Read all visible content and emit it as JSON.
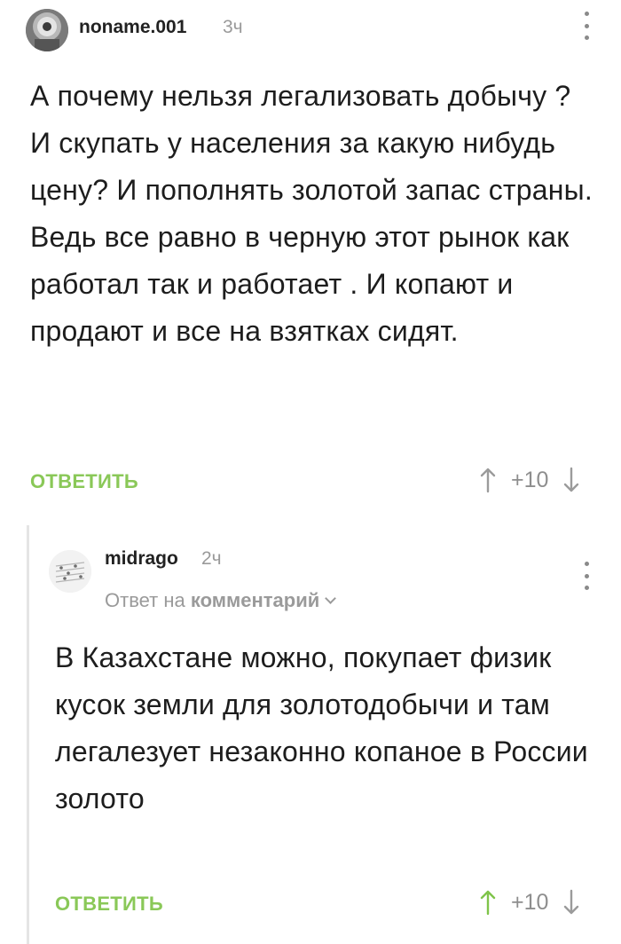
{
  "comments": [
    {
      "username": "noname.001",
      "time": "3ч",
      "text": "А почему нельзя легализовать добычу ? И скупать у населения за какую нибудь цену? И пополнять золотой запас страны. Ведь все равно в черную этот рынок как работал так и работает . И копают и продают и все на взятках сидят.",
      "reply_label": "ОТВЕТИТЬ",
      "score": "+10",
      "upvote_color": "#9b9b9b"
    },
    {
      "username": "midrago",
      "time": "2ч",
      "reply_to_prefix": "Ответ на",
      "reply_to_link": "комментарий",
      "text": "В Казахстане можно, покупает физик кусок земли для золотодобычи и там легалезует незаконно копаное в России золото",
      "reply_label": "ОТВЕТИТЬ",
      "score": "+10",
      "upvote_color": "#7fc44a"
    }
  ],
  "colors": {
    "accent_green": "#8ac858",
    "muted_gray": "#9a9a9a",
    "thread_line": "#e5e5e5"
  }
}
